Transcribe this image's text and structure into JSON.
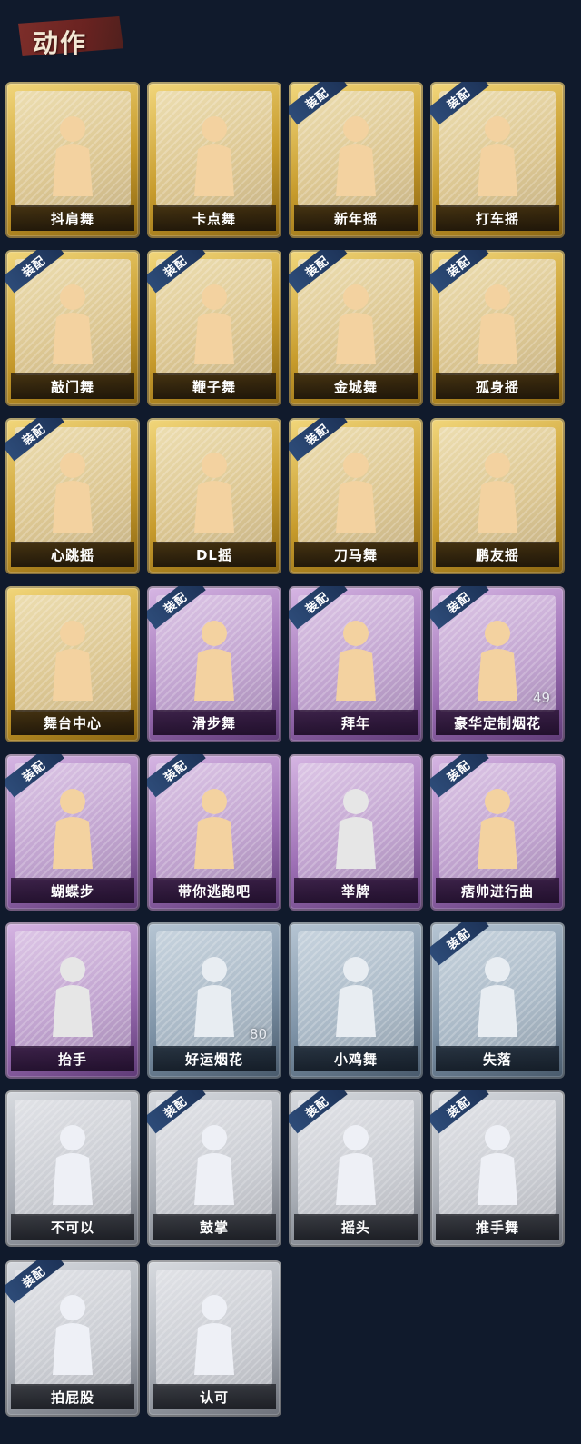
{
  "section": {
    "title": "动作"
  },
  "badge_text": "装配",
  "colors": {
    "background": "#101a2c",
    "gold": "#d8b24a",
    "purple": "#a87ec0",
    "blue": "#8aa0b6",
    "gray": "#b4b8bf",
    "badge": "#24406a",
    "header_banner": "#742a27"
  },
  "cards": [
    {
      "label": "抖肩舞",
      "tier": "gold",
      "equipped": false,
      "icon": "shoulder-shake-figure-icon"
    },
    {
      "label": "卡点舞",
      "tier": "gold",
      "equipped": false,
      "icon": "beat-dance-figure-icon"
    },
    {
      "label": "新年摇",
      "tier": "gold",
      "equipped": true,
      "icon": "new-year-sway-figure-icon"
    },
    {
      "label": "打车摇",
      "tier": "gold",
      "equipped": true,
      "icon": "taxi-sway-figure-icon"
    },
    {
      "label": "敲门舞",
      "tier": "gold",
      "equipped": true,
      "icon": "knock-dance-figure-icon"
    },
    {
      "label": "鞭子舞",
      "tier": "gold",
      "equipped": true,
      "icon": "whip-dance-figure-icon"
    },
    {
      "label": "金城舞",
      "tier": "gold",
      "equipped": true,
      "icon": "golden-city-dance-figure-icon"
    },
    {
      "label": "孤身摇",
      "tier": "gold",
      "equipped": true,
      "icon": "solo-sway-figure-icon"
    },
    {
      "label": "心跳摇",
      "tier": "gold",
      "equipped": true,
      "icon": "heartbeat-sway-figure-icon"
    },
    {
      "label": "DL摇",
      "tier": "gold",
      "equipped": false,
      "icon": "dl-sway-figure-icon"
    },
    {
      "label": "刀马舞",
      "tier": "gold",
      "equipped": true,
      "icon": "sword-horse-dance-figure-icon"
    },
    {
      "label": "鹏友摇",
      "tier": "gold",
      "equipped": false,
      "icon": "friend-sway-figure-icon"
    },
    {
      "label": "舞台中心",
      "tier": "gold",
      "equipped": false,
      "icon": "stage-center-figure-icon"
    },
    {
      "label": "滑步舞",
      "tier": "purple",
      "equipped": true,
      "icon": "slide-step-figure-icon"
    },
    {
      "label": "拜年",
      "tier": "purple",
      "equipped": true,
      "icon": "new-year-greeting-figure-icon"
    },
    {
      "label": "豪华定制烟花",
      "tier": "purple",
      "equipped": true,
      "icon": "deluxe-fireworks-icon",
      "count": "49"
    },
    {
      "label": "蝴蝶步",
      "tier": "purple",
      "equipped": true,
      "icon": "butterfly-step-figure-icon"
    },
    {
      "label": "带你逃跑吧",
      "tier": "purple",
      "equipped": true,
      "icon": "run-away-figure-icon"
    },
    {
      "label": "举牌",
      "tier": "purple",
      "equipped": false,
      "icon": "hold-sign-figure-icon"
    },
    {
      "label": "痞帅进行曲",
      "tier": "purple",
      "equipped": true,
      "icon": "cool-march-figure-icon"
    },
    {
      "label": "抬手",
      "tier": "purple",
      "equipped": false,
      "icon": "raise-hand-figure-icon"
    },
    {
      "label": "好运烟花",
      "tier": "blue",
      "equipped": false,
      "icon": "lucky-fireworks-icon",
      "count": "80"
    },
    {
      "label": "小鸡舞",
      "tier": "blue",
      "equipped": false,
      "icon": "chicken-dance-figure-icon"
    },
    {
      "label": "失落",
      "tier": "blue",
      "equipped": true,
      "icon": "dejected-figure-icon"
    },
    {
      "label": "不可以",
      "tier": "gray",
      "equipped": false,
      "icon": "finger-wag-icon"
    },
    {
      "label": "鼓掌",
      "tier": "gray",
      "equipped": true,
      "icon": "clapping-hands-icon"
    },
    {
      "label": "摇头",
      "tier": "gray",
      "equipped": true,
      "icon": "head-shake-figure-icon"
    },
    {
      "label": "推手舞",
      "tier": "gray",
      "equipped": true,
      "icon": "push-hand-dance-figure-icon"
    },
    {
      "label": "拍屁股",
      "tier": "gray",
      "equipped": true,
      "icon": "butt-pat-figure-icon"
    },
    {
      "label": "认可",
      "tier": "gray",
      "equipped": false,
      "icon": "thumbs-up-icon"
    }
  ]
}
